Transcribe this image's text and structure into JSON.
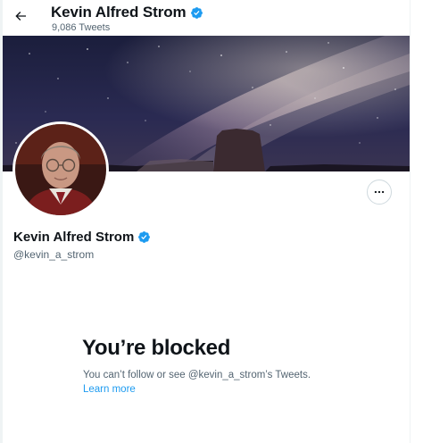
{
  "header": {
    "back_icon": "arrow-left-icon",
    "name": "Kevin Alfred Strom",
    "tweet_count": "9,086 Tweets"
  },
  "profile": {
    "name": "Kevin Alfred Strom",
    "handle": "@kevin_a_strom",
    "verified_icon": "verified-badge-icon",
    "more_icon": "more-horizontal-icon"
  },
  "blocked": {
    "title": "You’re blocked",
    "description": "You can’t follow or see @kevin_a_strom’s Tweets.",
    "learn_more": "Learn more"
  },
  "colors": {
    "accent": "#1d9bf0",
    "text": "#0f1419",
    "muted": "#536471"
  }
}
